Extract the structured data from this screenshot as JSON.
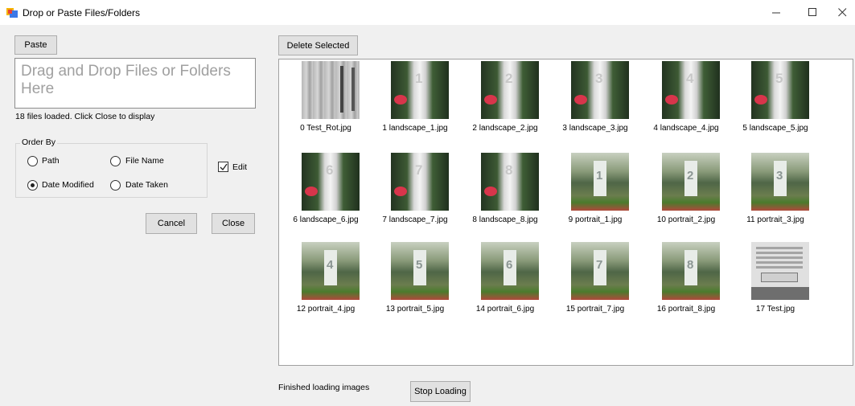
{
  "window": {
    "title": "Drop or Paste Files/Folders"
  },
  "left": {
    "paste_label": "Paste",
    "drop_placeholder": "Drag and Drop Files or Folders Here",
    "status": "18 files loaded. Click Close to display",
    "order_by": {
      "label": "Order By",
      "options": [
        {
          "label": "Path",
          "selected": false
        },
        {
          "label": "File Name",
          "selected": false
        },
        {
          "label": "Date Modified",
          "selected": true
        },
        {
          "label": "Date Taken",
          "selected": false
        }
      ]
    },
    "edit": {
      "label": "Edit",
      "checked": true
    },
    "cancel_label": "Cancel",
    "close_label": "Close"
  },
  "right": {
    "delete_label": "Delete Selected",
    "status": "Finished loading images",
    "stop_label": "Stop Loading",
    "images": [
      {
        "caption": "0 Test_Rot.jpg",
        "kind": "rotated-test"
      },
      {
        "caption": "1 landscape_1.jpg",
        "kind": "landscape",
        "number": "1"
      },
      {
        "caption": "2 landscape_2.jpg",
        "kind": "landscape",
        "number": "2"
      },
      {
        "caption": "3 landscape_3.jpg",
        "kind": "landscape",
        "number": "3"
      },
      {
        "caption": "4 landscape_4.jpg",
        "kind": "landscape",
        "number": "4"
      },
      {
        "caption": "5 landscape_5.jpg",
        "kind": "landscape",
        "number": "5"
      },
      {
        "caption": "6 landscape_6.jpg",
        "kind": "landscape",
        "number": "6"
      },
      {
        "caption": "7 landscape_7.jpg",
        "kind": "landscape",
        "number": "7"
      },
      {
        "caption": "8 landscape_8.jpg",
        "kind": "landscape",
        "number": "8"
      },
      {
        "caption": "9 portrait_1.jpg",
        "kind": "portrait",
        "number": "1"
      },
      {
        "caption": "10 portrait_2.jpg",
        "kind": "portrait",
        "number": "2"
      },
      {
        "caption": "11 portrait_3.jpg",
        "kind": "portrait",
        "number": "3"
      },
      {
        "caption": "12 portrait_4.jpg",
        "kind": "portrait",
        "number": "4"
      },
      {
        "caption": "13 portrait_5.jpg",
        "kind": "portrait",
        "number": "5"
      },
      {
        "caption": "14 portrait_6.jpg",
        "kind": "portrait",
        "number": "6"
      },
      {
        "caption": "15 portrait_7.jpg",
        "kind": "portrait",
        "number": "7"
      },
      {
        "caption": "16 portrait_8.jpg",
        "kind": "portrait",
        "number": "8"
      },
      {
        "caption": "17 Test.jpg",
        "kind": "document"
      }
    ]
  },
  "icons": {
    "app": "app-window-icon",
    "minimize": "minimize-icon",
    "maximize": "maximize-icon",
    "close": "close-icon",
    "check": "check-icon"
  }
}
